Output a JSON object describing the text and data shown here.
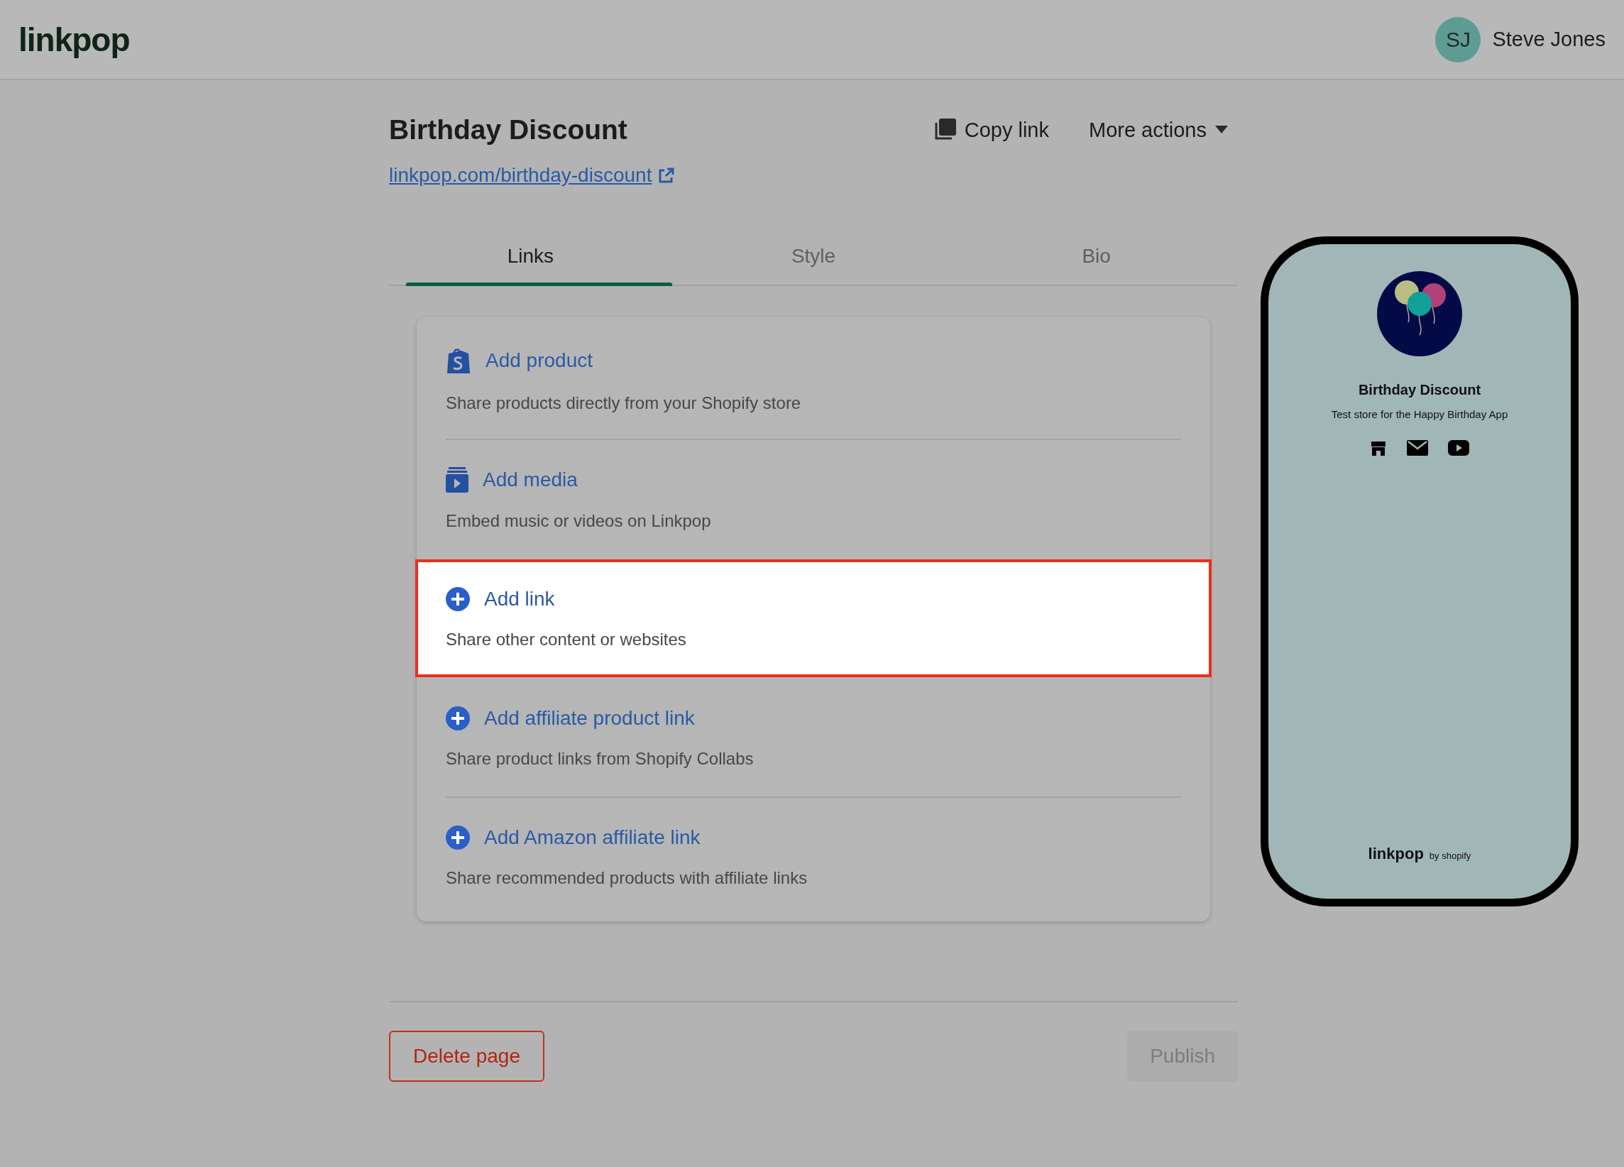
{
  "header": {
    "logo": "linkpop",
    "user": {
      "initials": "SJ",
      "name": "Steve Jones"
    }
  },
  "page": {
    "title": "Birthday Discount",
    "url": "linkpop.com/birthday-discount",
    "actions": [
      {
        "kind": "copy",
        "label": "Copy link"
      },
      {
        "kind": "menu",
        "label": "More actions"
      }
    ]
  },
  "tabs": [
    {
      "label": "Links",
      "selected": true
    },
    {
      "label": "Style",
      "selected": false
    },
    {
      "label": "Bio",
      "selected": false
    }
  ],
  "options": [
    {
      "kind": "shopify",
      "title": "Add product",
      "description": "Share products directly from your Shopify store",
      "selected": false
    },
    {
      "kind": "media",
      "title": "Add media",
      "description": "Embed music or videos on Linkpop",
      "selected": false
    },
    {
      "kind": "plus",
      "title": "Add link",
      "description": "Share other content or websites",
      "selected": true
    },
    {
      "kind": "plus",
      "title": "Add affiliate product link",
      "description": "Share product links from Shopify Collabs",
      "selected": false
    },
    {
      "kind": "plus",
      "title": "Add Amazon affiliate link",
      "description": "Share recommended products with affiliate links",
      "selected": false
    }
  ],
  "footer": {
    "delete": "Delete page",
    "publish": {
      "label": "Publish",
      "disabled": true
    }
  },
  "preview": {
    "title": "Birthday Discount",
    "subtitle": "Test store for the Happy Birthday App",
    "socials": [
      {
        "kind": "store"
      },
      {
        "kind": "mail"
      },
      {
        "kind": "youtube"
      }
    ],
    "brand": "linkpop",
    "brand_suffix": "by shopify"
  }
}
